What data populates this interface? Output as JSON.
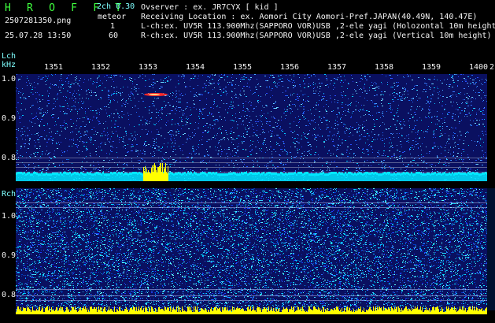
{
  "header": {
    "app_title": "H R O F F T",
    "filename": "2507281350.png",
    "datetime": "25.07.28 13:50",
    "channel_mode": "2ch 0.30",
    "mode_label": "meteor",
    "count_1": "1",
    "count_2": "60",
    "observer_line": "Ovserver         : ex. JR7CYX [ kid ]",
    "location_line": "Receiving Location : ex. Aomori City Aomori-Pref.JAPAN(40.49N, 140.47E)",
    "lch_line": "L-ch:ex. UV5R 113.900Mhz(SAPPORO VOR)USB ,2-ele yagi (Holozontal 10m height)",
    "rch_line": "R-ch:ex. UV5R 113.900Mhz(SAPPORO VOR)USB ,2-ele yagi (Vertical 10m height)"
  },
  "lch_panel": {
    "label": "Lch",
    "unit": "kHz",
    "y_ticks": [
      "1.0",
      "0.9",
      "0.8"
    ],
    "x_ticks": [
      "1351",
      "1352",
      "1353",
      "1354",
      "1355",
      "1356",
      "1357",
      "1358",
      "1359",
      "1400",
      "2"
    ]
  },
  "rch_panel": {
    "label": "Rch",
    "y_ticks": [
      "1.0",
      "0.9",
      "0.8"
    ]
  },
  "colors": {
    "label_cyan": "#7fffff",
    "title_green": "#3fff3f",
    "text_white": "#f4f4f4",
    "waterfall_bg": "#0a1060",
    "noise_cyan": "#00e8ff",
    "meteor_yellow": "#ffff00"
  }
}
